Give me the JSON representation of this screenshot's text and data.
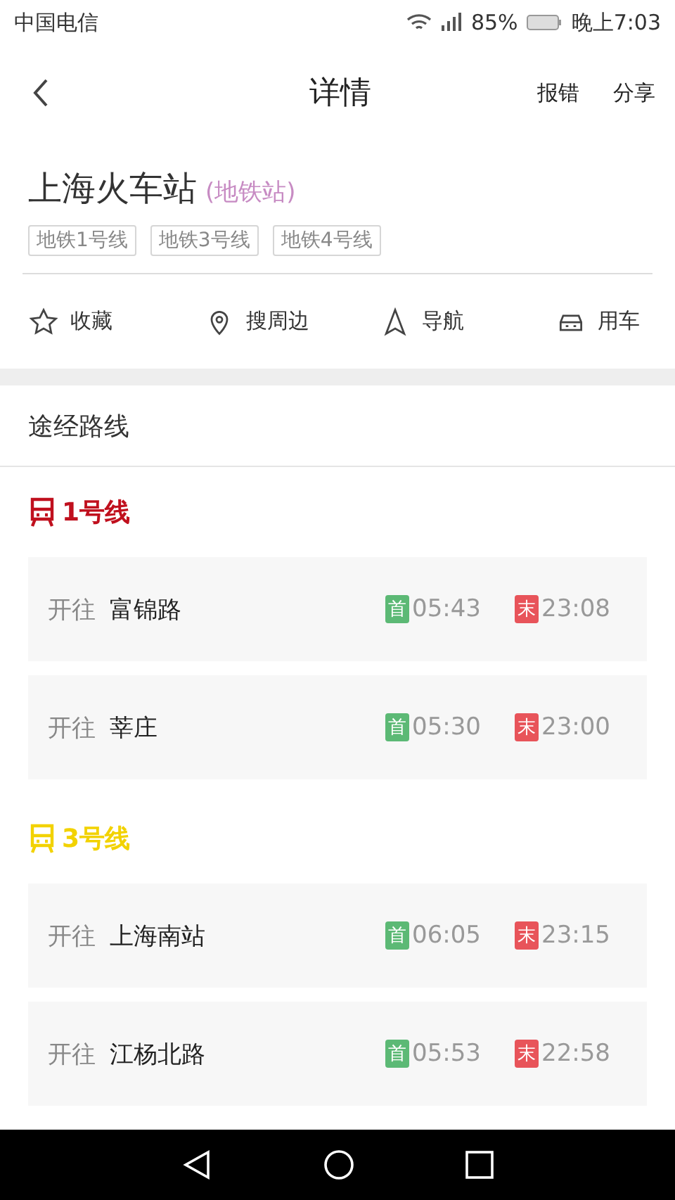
{
  "status_bar": {
    "carrier": "中国电信",
    "battery": "85%",
    "time": "晚上7:03"
  },
  "header": {
    "title": "详情",
    "actions": [
      "报错",
      "分享"
    ]
  },
  "station": {
    "name": "上海火车站",
    "type": "(地铁站)",
    "tags": [
      "地铁1号线",
      "地铁3号线",
      "地铁4号线"
    ]
  },
  "actions": [
    {
      "kind": "star",
      "label": "收藏"
    },
    {
      "kind": "pin",
      "label": "搜周边"
    },
    {
      "kind": "nav",
      "label": "导航"
    },
    {
      "kind": "car",
      "label": "用车"
    }
  ],
  "section_title": "途经路线",
  "lines": [
    {
      "name": "1号线",
      "color": "#c0101e",
      "directions": [
        {
          "prefix": "开往",
          "destination": "富锦路",
          "first_badge": "首",
          "first": "05:43",
          "last_badge": "末",
          "last": "23:08"
        },
        {
          "prefix": "开往",
          "destination": "莘庄",
          "first_badge": "首",
          "first": "05:30",
          "last_badge": "末",
          "last": "23:00"
        }
      ]
    },
    {
      "name": "3号线",
      "color": "#f2d200",
      "directions": [
        {
          "prefix": "开往",
          "destination": "上海南站",
          "first_badge": "首",
          "first": "06:05",
          "last_badge": "末",
          "last": "23:15"
        },
        {
          "prefix": "开往",
          "destination": "江杨北路",
          "first_badge": "首",
          "first": "05:53",
          "last_badge": "末",
          "last": "22:58"
        }
      ]
    }
  ]
}
